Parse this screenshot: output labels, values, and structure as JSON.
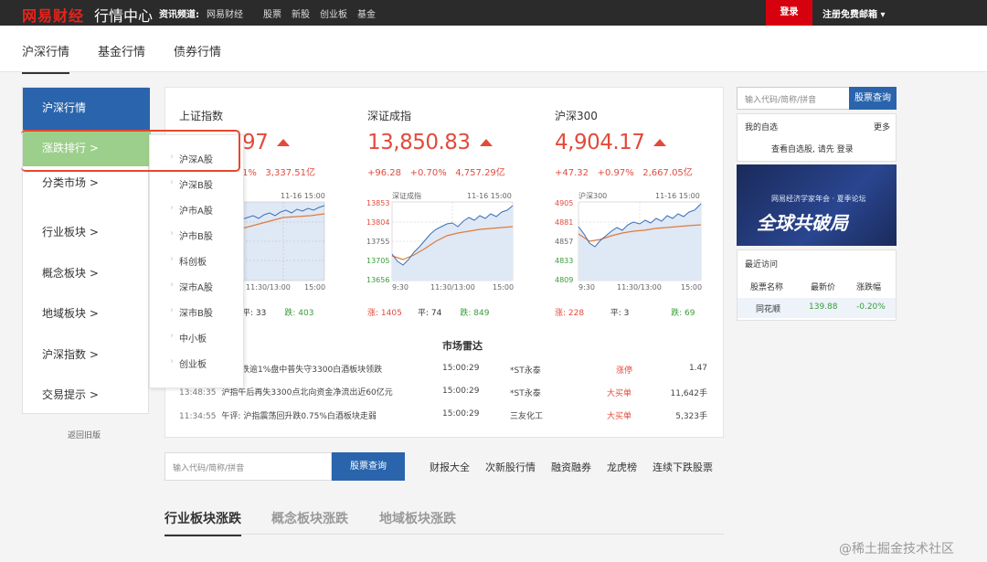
{
  "topbar": {
    "logo_a": "网易",
    "logo_b": "财经",
    "app_title": "行情中心",
    "channel_label": "资讯频道:",
    "links": [
      "网易财经",
      "股票",
      "新股",
      "创业板",
      "基金"
    ],
    "login": "登录",
    "register": "注册免费邮箱"
  },
  "subnav": {
    "tabs": [
      "沪深行情",
      "基金行情",
      "债券行情"
    ]
  },
  "sidebar": {
    "items": [
      "沪深行情",
      "涨跌排行 >",
      "分类市场 >",
      "行业板块 >",
      "概念板块 >",
      "地域板块 >",
      "沪深指数 >",
      "交易提示 >"
    ],
    "old_version": "返回旧版"
  },
  "flyout": {
    "items": [
      "沪深A股",
      "沪深B股",
      "沪市A股",
      "沪市B股",
      "科创板",
      "深市A股",
      "深市B股",
      "中小板",
      "创业板"
    ]
  },
  "indices": [
    {
      "name": "上证指数",
      "value": "97",
      "chg": "",
      "pct": "1%",
      "amount": "3,337.51亿",
      "time": "11-16 15:00",
      "tick_left": "",
      "t0": "",
      "t1": "11:30/13:00",
      "t2": "15:00",
      "up": "",
      "flat": "平: 33",
      "down": "跌: 403"
    },
    {
      "name": "深证成指",
      "value": "13,850.83",
      "chg": "+96.28",
      "pct": "+0.70%",
      "amount": "4,757.29亿",
      "label": "深证成指",
      "time": "11-16 15:00",
      "ticks": [
        "13853",
        "13804",
        "13755",
        "13705",
        "13656"
      ],
      "t0": "9:30",
      "t1": "11:30/13:00",
      "t2": "15:00",
      "up": "涨: 1405",
      "flat": "平: 74",
      "down": "跌: 849"
    },
    {
      "name": "沪深300",
      "value": "4,904.17",
      "chg": "+47.32",
      "pct": "+0.97%",
      "amount": "2,667.05亿",
      "label": "沪深300",
      "time": "11-16 15:00",
      "ticks": [
        "4905",
        "4881",
        "4857",
        "4833",
        "4809"
      ],
      "t0": "9:30",
      "t1": "11:30/13:00",
      "t2": "15:00",
      "up": "涨: 228",
      "flat": "平: 3",
      "down": "跌: 69"
    }
  ],
  "news": [
    {
      "time": "",
      "text": "跌逾1%盘中普失守3300白酒板块领跌"
    },
    {
      "time": "13:48:35",
      "text": "沪指午后再失3300点北向资金净流出近60亿元"
    },
    {
      "time": "11:34:55",
      "text": "午评: 沪指震荡回升跌0.75%白酒板块走弱"
    }
  ],
  "radar": {
    "title": "市场雷达",
    "rows": [
      {
        "time": "15:00:29",
        "name": "*ST永泰",
        "event": "涨停",
        "value": "1.47"
      },
      {
        "time": "15:00:29",
        "name": "*ST永泰",
        "event": "大买单",
        "value": "11,642手"
      },
      {
        "time": "15:00:29",
        "name": "三友化工",
        "event": "大买单",
        "value": "5,323手"
      }
    ]
  },
  "right": {
    "search_placeholder": "输入代码/简称/拼音",
    "search_btn": "股票查询",
    "watch_title": "我的自选",
    "watch_more": "更多",
    "watch_tip": "查看自选股, 请先",
    "watch_login": "登录",
    "banner_line1": "网易经济学家年会 · 夏季论坛",
    "banner_line2": "全球共破局",
    "recent_title": "最近访问",
    "recent_cols": [
      "股票名称",
      "最新价",
      "涨跌幅"
    ],
    "recent_row": [
      "同花顺",
      "139.88",
      "-0.20%"
    ]
  },
  "bottom": {
    "search_placeholder": "输入代码/简称/拼音",
    "search_btn": "股票查询",
    "links": [
      "财报大全",
      "次新股行情",
      "融资融券",
      "龙虎榜",
      "连续下跌股票"
    ],
    "tabs": [
      "行业板块涨跌",
      "概念板块涨跌",
      "地域板块涨跌"
    ]
  },
  "watermark": "@稀土掘金技术社区",
  "colors": {
    "red": "#e34a3c",
    "green": "#3a9b3a",
    "blue": "#2a64ad"
  }
}
